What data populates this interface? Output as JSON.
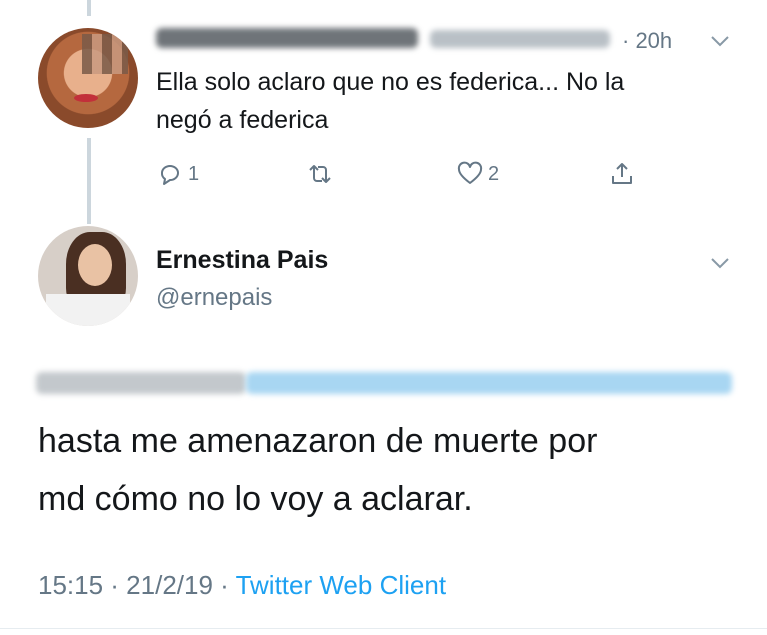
{
  "reply": {
    "time": "· 20h",
    "text_line1": "Ella solo aclaro que no es federica... No la",
    "text_line2": "negó a federica",
    "actions": {
      "reply_count": "1",
      "retweet_count": "",
      "like_count": "2"
    }
  },
  "tweet": {
    "display_name": "Ernestina Pais",
    "handle": "@ernepais",
    "text_line1": "hasta me amenazaron de muerte por",
    "text_line2": "md cómo no lo voy a aclarar.",
    "timestamp": "15:15 · 21/2/19 · ",
    "source": "Twitter Web Client"
  },
  "colors": {
    "accent": "#1da1f2",
    "muted": "#657786",
    "text": "#14171a",
    "thread": "#ccd6dd"
  },
  "icons": [
    "reply-icon",
    "retweet-icon",
    "like-icon",
    "share-icon",
    "chevron-down-icon"
  ]
}
